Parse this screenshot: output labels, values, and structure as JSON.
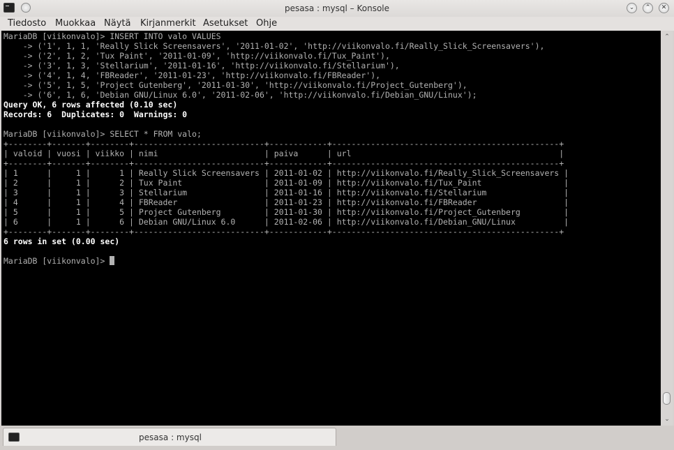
{
  "window": {
    "title": "pesasa : mysql – Konsole",
    "minimize_glyph": "⌄",
    "maximize_glyph": "⌃",
    "close_glyph": "✕"
  },
  "menu": [
    "Tiedosto",
    "Muokkaa",
    "Näytä",
    "Kirjanmerkit",
    "Asetukset",
    "Ohje"
  ],
  "terminal": {
    "lines": [
      {
        "text": "MariaDB [viikonvalo]> INSERT INTO valo VALUES",
        "bold": false
      },
      {
        "text": "    -> ('1', 1, 1, 'Really Slick Screensavers', '2011-01-02', 'http://viikonvalo.fi/Really_Slick_Screensavers'),",
        "bold": false
      },
      {
        "text": "    -> ('2', 1, 2, 'Tux Paint', '2011-01-09', 'http://viikonvalo.fi/Tux_Paint'),",
        "bold": false
      },
      {
        "text": "    -> ('3', 1, 3, 'Stellarium', '2011-01-16', 'http://viikonvalo.fi/Stellarium'),",
        "bold": false
      },
      {
        "text": "    -> ('4', 1, 4, 'FBReader', '2011-01-23', 'http://viikonvalo.fi/FBReader'),",
        "bold": false
      },
      {
        "text": "    -> ('5', 1, 5, 'Project Gutenberg', '2011-01-30', 'http://viikonvalo.fi/Project_Gutenberg'),",
        "bold": false
      },
      {
        "text": "    -> ('6', 1, 6, 'Debian GNU/Linux 6.0', '2011-02-06', 'http://viikonvalo.fi/Debian_GNU/Linux');",
        "bold": false
      },
      {
        "text": "Query OK, 6 rows affected (0.10 sec)",
        "bold": true
      },
      {
        "text": "Records: 6  Duplicates: 0  Warnings: 0",
        "bold": true
      },
      {
        "text": "",
        "bold": false
      },
      {
        "text": "MariaDB [viikonvalo]> SELECT * FROM valo;",
        "bold": false
      },
      {
        "text": "+--------+-------+--------+---------------------------+------------+-----------------------------------------------+",
        "bold": false
      },
      {
        "text": "| valoid | vuosi | viikko | nimi                      | paiva      | url                                           |",
        "bold": false
      },
      {
        "text": "+--------+-------+--------+---------------------------+------------+-----------------------------------------------+",
        "bold": false
      },
      {
        "text": "| 1      |     1 |      1 | Really Slick Screensavers | 2011-01-02 | http://viikonvalo.fi/Really_Slick_Screensavers |",
        "bold": false
      },
      {
        "text": "| 2      |     1 |      2 | Tux Paint                 | 2011-01-09 | http://viikonvalo.fi/Tux_Paint                 |",
        "bold": false
      },
      {
        "text": "| 3      |     1 |      3 | Stellarium                | 2011-01-16 | http://viikonvalo.fi/Stellarium                |",
        "bold": false
      },
      {
        "text": "| 4      |     1 |      4 | FBReader                  | 2011-01-23 | http://viikonvalo.fi/FBReader                  |",
        "bold": false
      },
      {
        "text": "| 5      |     1 |      5 | Project Gutenberg         | 2011-01-30 | http://viikonvalo.fi/Project_Gutenberg         |",
        "bold": false
      },
      {
        "text": "| 6      |     1 |      6 | Debian GNU/Linux 6.0      | 2011-02-06 | http://viikonvalo.fi/Debian_GNU/Linux          |",
        "bold": false
      },
      {
        "text": "+--------+-------+--------+---------------------------+------------+-----------------------------------------------+",
        "bold": false
      },
      {
        "text": "6 rows in set (0.00 sec)",
        "bold": true
      },
      {
        "text": "",
        "bold": false
      }
    ],
    "prompt": "MariaDB [viikonvalo]> "
  },
  "tab": {
    "label": "pesasa : mysql"
  },
  "icons": {
    "app": "terminal-icon",
    "pin": "keep-above-icon",
    "tab": "terminal-icon"
  }
}
